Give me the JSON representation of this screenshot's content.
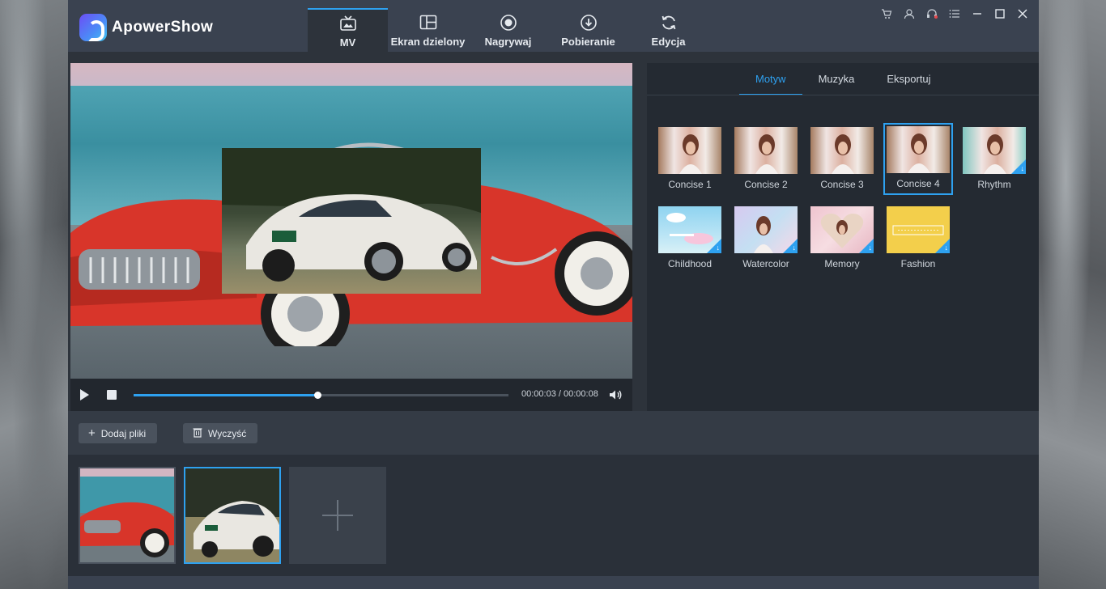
{
  "app": {
    "title": "ApowerShow"
  },
  "nav": {
    "tabs": [
      {
        "label": "MV",
        "icon": "tv-icon",
        "active": true
      },
      {
        "label": "Ekran dzielony",
        "icon": "split-screen-icon",
        "active": false
      },
      {
        "label": "Nagrywaj",
        "icon": "record-icon",
        "active": false
      },
      {
        "label": "Pobieranie",
        "icon": "download-icon",
        "active": false
      },
      {
        "label": "Edycja",
        "icon": "refresh-icon",
        "active": false
      }
    ]
  },
  "window_controls": [
    "cart-icon",
    "user-icon",
    "support-icon",
    "menu-icon",
    "minimize-icon",
    "maximize-icon",
    "close-icon"
  ],
  "player": {
    "current_time": "00:00:03",
    "total_time": "00:00:08",
    "time_display": "00:00:03 / 00:00:08",
    "progress_fraction": 0.49
  },
  "right_panel": {
    "tabs": [
      {
        "label": "Motyw",
        "active": true
      },
      {
        "label": "Muzyka",
        "active": false
      },
      {
        "label": "Eksportuj",
        "active": false
      }
    ],
    "themes": [
      {
        "name": "Concise 1",
        "downloadable": false,
        "selected": false
      },
      {
        "name": "Concise 2",
        "downloadable": false,
        "selected": false
      },
      {
        "name": "Concise 3",
        "downloadable": false,
        "selected": false
      },
      {
        "name": "Concise 4",
        "downloadable": false,
        "selected": true
      },
      {
        "name": "Rhythm",
        "downloadable": true,
        "selected": false
      },
      {
        "name": "Childhood",
        "downloadable": true,
        "selected": false
      },
      {
        "name": "Watercolor",
        "downloadable": true,
        "selected": false
      },
      {
        "name": "Memory",
        "downloadable": true,
        "selected": false
      },
      {
        "name": "Fashion",
        "downloadable": true,
        "selected": false
      }
    ]
  },
  "toolbar": {
    "add_files_label": "Dodaj pliki",
    "clear_label": "Wyczyść"
  },
  "clips": [
    {
      "name": "red-sports-car-clip",
      "selected": false
    },
    {
      "name": "white-sports-car-clip",
      "selected": true
    }
  ],
  "colors": {
    "accent": "#2ea1f0",
    "header_bg": "#3a4250",
    "panel_bg": "#242a32"
  }
}
